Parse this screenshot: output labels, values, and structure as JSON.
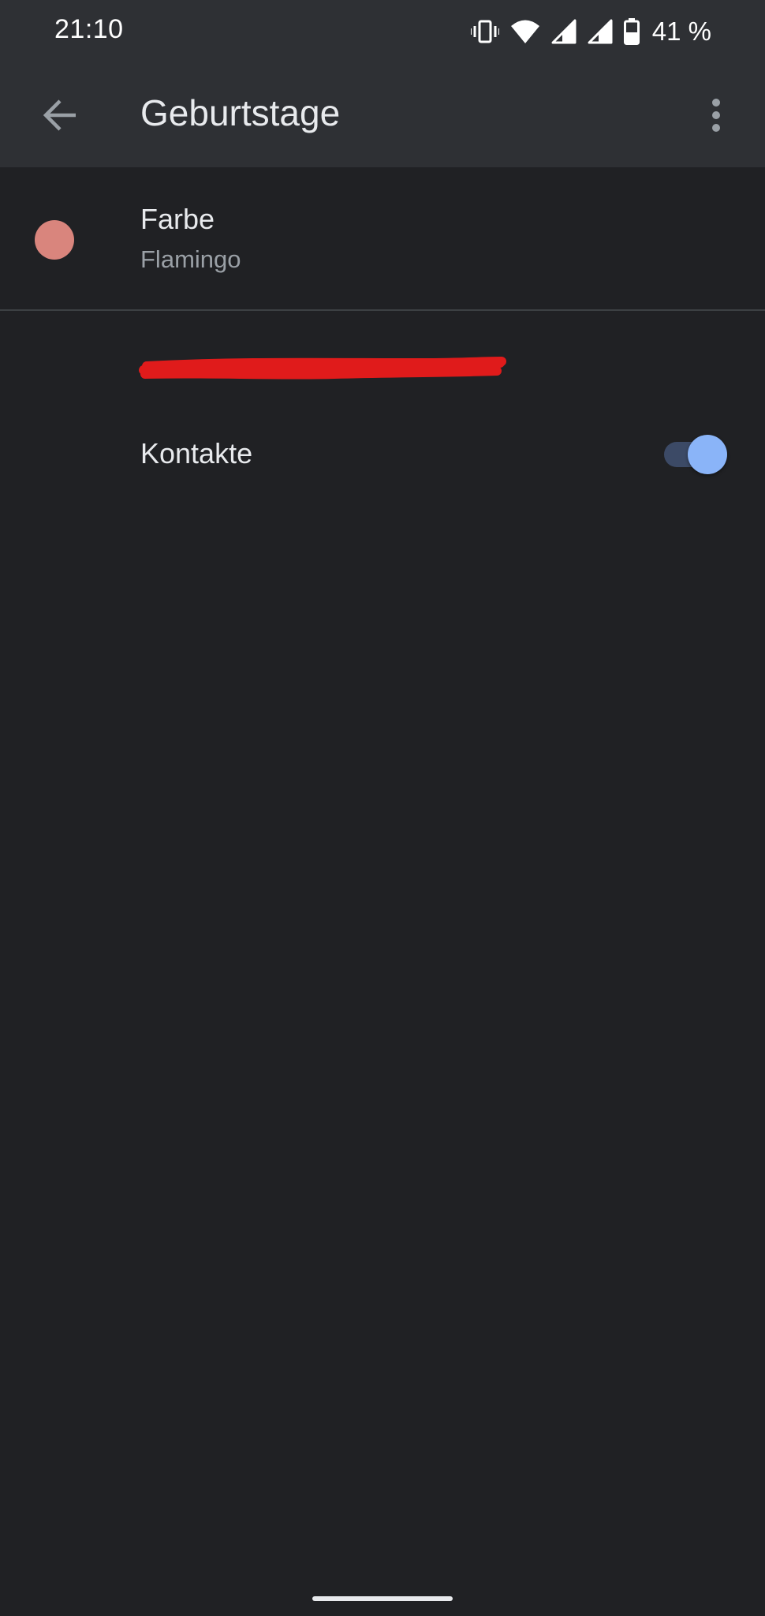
{
  "status_bar": {
    "time": "21:10",
    "battery_percent": "41 %",
    "icons": [
      "vibrate-icon",
      "wifi-icon",
      "signal-icon",
      "signal-icon",
      "battery-icon"
    ]
  },
  "app_bar": {
    "title": "Geburtstage",
    "back_icon": "arrow-back-icon",
    "menu_icon": "more-vert-icon"
  },
  "color_setting": {
    "label": "Farbe",
    "value": "Flamingo",
    "swatch_color": "#d9857d"
  },
  "contacts_setting": {
    "label": "Kontakte",
    "enabled": true,
    "accent_color": "#8ab4f8"
  },
  "colors": {
    "background": "#202124",
    "surface": "#2e3034",
    "divider": "#3c4043",
    "redaction": "#e01b1b"
  }
}
